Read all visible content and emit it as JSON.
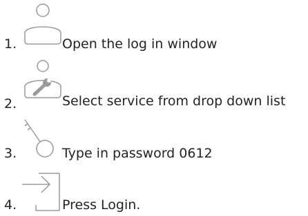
{
  "steps": [
    {
      "number": "1.",
      "icon": "user-icon",
      "text": "Open the log in window"
    },
    {
      "number": "2.",
      "icon": "service-user-icon",
      "text": "Select service from drop down list"
    },
    {
      "number": "3.",
      "icon": "key-icon",
      "text": "Type in password 0612"
    },
    {
      "number": "4.",
      "icon": "login-icon",
      "text": "Press Login."
    }
  ],
  "colors": {
    "icon_stroke": "#9a9a9a",
    "text": "#222222"
  }
}
